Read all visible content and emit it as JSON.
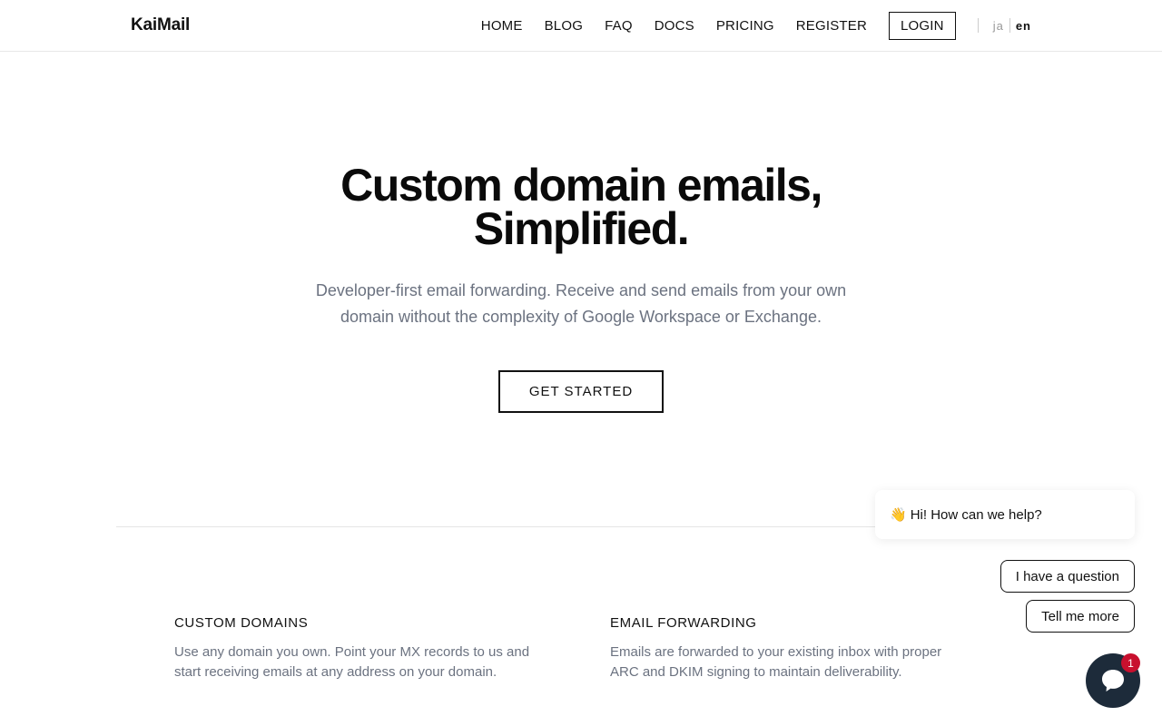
{
  "header": {
    "logo": "KaiMail",
    "nav": [
      "HOME",
      "BLOG",
      "FAQ",
      "DOCS",
      "PRICING",
      "REGISTER"
    ],
    "login": "LOGIN",
    "lang": {
      "ja": "ja",
      "en": "en"
    }
  },
  "hero": {
    "title_line1": "Custom domain emails,",
    "title_line2": "Simplified.",
    "subtitle": "Developer-first email forwarding. Receive and send emails from your own domain without the complexity of Google Workspace or Exchange.",
    "cta": "GET STARTED"
  },
  "features": [
    {
      "title": "CUSTOM DOMAINS",
      "desc": "Use any domain you own. Point your MX records to us and start receiving emails at any address on your domain."
    },
    {
      "title": "EMAIL FORWARDING",
      "desc": "Emails are forwarded to your existing inbox with proper ARC and DKIM signing to maintain deliverability."
    }
  ],
  "chat": {
    "greeting_emoji": "👋",
    "greeting": "Hi! How can we help?",
    "option1": "I have a question",
    "option2": "Tell me more",
    "badge": "1",
    "launcher_icon": "chat-icon"
  },
  "colors": {
    "accent": "#111111",
    "muted": "#6b7280",
    "launcher": "#1d2b3a",
    "badge": "#c8102e"
  }
}
